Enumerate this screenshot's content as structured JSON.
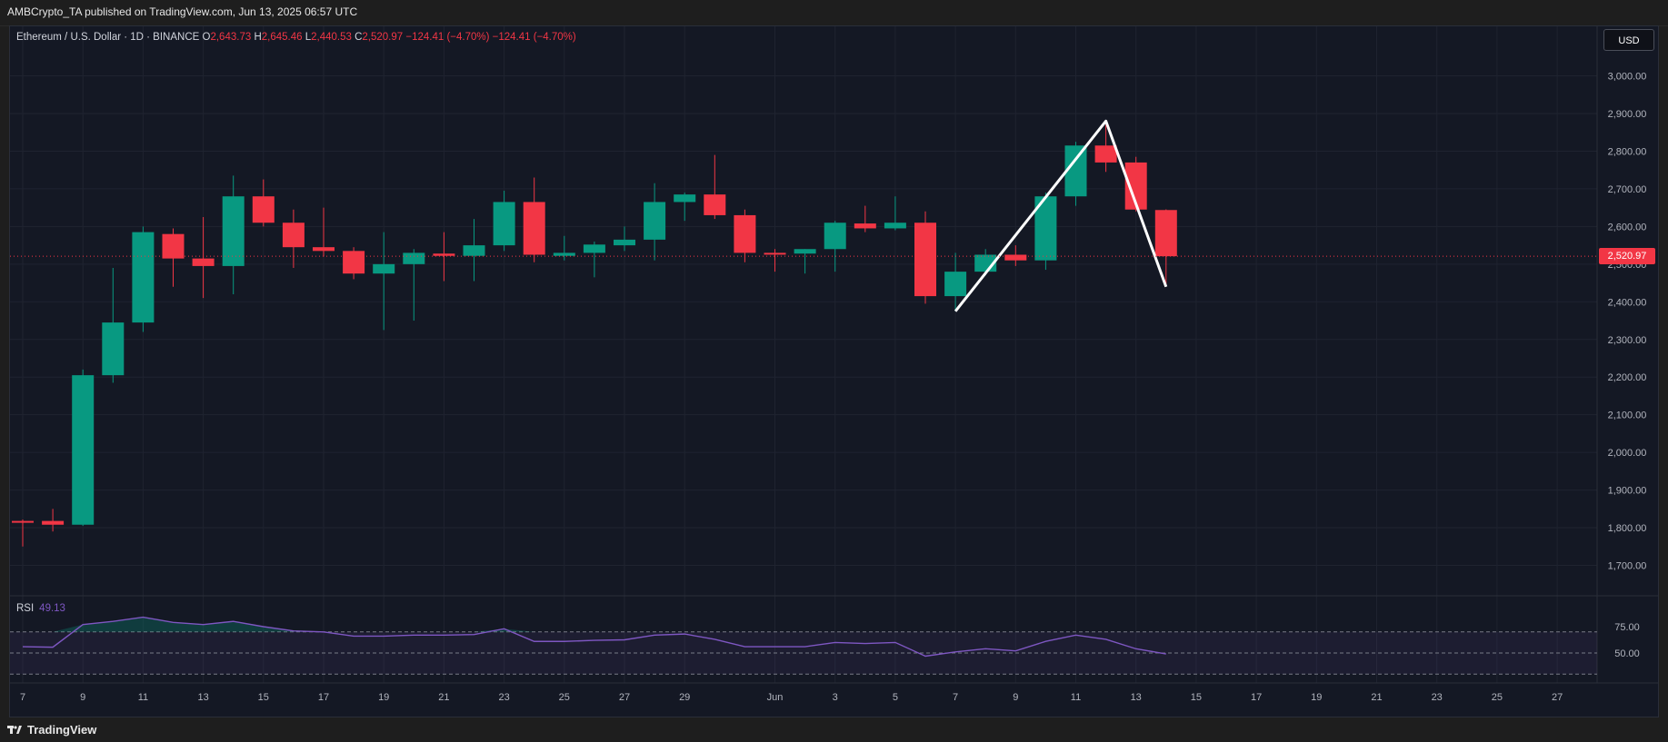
{
  "header": {
    "publisher": "AMBCrypto_TA published on TradingView.com, Jun 13, 2025 06:57 UTC"
  },
  "legend": {
    "symbol": "Ethereum / U.S. Dollar · 1D · BINANCE",
    "o_label": "O",
    "o": "2,643.73",
    "h_label": "H",
    "h": "2,645.46",
    "l_label": "L",
    "l": "2,440.53",
    "c_label": "C",
    "c": "2,520.97",
    "change": "−124.41 (−4.70%)",
    "change2": "−124.41 (−4.70%)"
  },
  "currency": "USD",
  "last_price": "2,520.97",
  "rsi": {
    "label": "RSI",
    "value": "49.13"
  },
  "footer": {
    "brand": "TradingView"
  },
  "colors": {
    "up": "#089981",
    "down": "#f23645",
    "rsi": "#7e57c2",
    "background": "#141824"
  },
  "chart_data": {
    "type": "candlestick",
    "title": "Ethereum / U.S. Dollar · 1D · BINANCE",
    "ylim": [
      1650,
      3050
    ],
    "y_ticks": [
      {
        "v": 1700,
        "label": "1,700.00"
      },
      {
        "v": 1800,
        "label": "1,800.00"
      },
      {
        "v": 1900,
        "label": "1,900.00"
      },
      {
        "v": 2000,
        "label": "2,000.00"
      },
      {
        "v": 2100,
        "label": "2,100.00"
      },
      {
        "v": 2200,
        "label": "2,200.00"
      },
      {
        "v": 2300,
        "label": "2,300.00"
      },
      {
        "v": 2400,
        "label": "2,400.00"
      },
      {
        "v": 2500,
        "label": "2,500.00"
      },
      {
        "v": 2600,
        "label": "2,600.00"
      },
      {
        "v": 2700,
        "label": "2,700.00"
      },
      {
        "v": 2800,
        "label": "2,800.00"
      },
      {
        "v": 2900,
        "label": "2,900.00"
      },
      {
        "v": 3000,
        "label": "3,000.00"
      }
    ],
    "x_ticks": [
      {
        "i": 0,
        "label": "7"
      },
      {
        "i": 2,
        "label": "9"
      },
      {
        "i": 4,
        "label": "11"
      },
      {
        "i": 6,
        "label": "13"
      },
      {
        "i": 8,
        "label": "15"
      },
      {
        "i": 10,
        "label": "17"
      },
      {
        "i": 12,
        "label": "19"
      },
      {
        "i": 14,
        "label": "21"
      },
      {
        "i": 16,
        "label": "23"
      },
      {
        "i": 18,
        "label": "25"
      },
      {
        "i": 20,
        "label": "27"
      },
      {
        "i": 22,
        "label": "29"
      },
      {
        "i": 25,
        "label": "Jun"
      },
      {
        "i": 27,
        "label": "3"
      },
      {
        "i": 29,
        "label": "5"
      },
      {
        "i": 31,
        "label": "7"
      },
      {
        "i": 33,
        "label": "9"
      },
      {
        "i": 35,
        "label": "11"
      },
      {
        "i": 37,
        "label": "13"
      },
      {
        "i": 39,
        "label": "15"
      },
      {
        "i": 41,
        "label": "17"
      },
      {
        "i": 43,
        "label": "19"
      },
      {
        "i": 45,
        "label": "21"
      },
      {
        "i": 47,
        "label": "23"
      },
      {
        "i": 49,
        "label": "25"
      },
      {
        "i": 51,
        "label": "27"
      }
    ],
    "candles": [
      {
        "date": "May 7",
        "o": 1818,
        "h": 1822,
        "l": 1750,
        "c": 1815
      },
      {
        "date": "May 8",
        "o": 1818,
        "h": 1850,
        "l": 1790,
        "c": 1808
      },
      {
        "date": "May 9",
        "o": 1808,
        "h": 2220,
        "l": 1805,
        "c": 2205
      },
      {
        "date": "May 10",
        "o": 2205,
        "h": 2490,
        "l": 2185,
        "c": 2345
      },
      {
        "date": "May 11",
        "o": 2345,
        "h": 2600,
        "l": 2320,
        "c": 2585
      },
      {
        "date": "May 12",
        "o": 2580,
        "h": 2595,
        "l": 2440,
        "c": 2515
      },
      {
        "date": "May 13",
        "o": 2515,
        "h": 2625,
        "l": 2410,
        "c": 2495
      },
      {
        "date": "May 14",
        "o": 2495,
        "h": 2735,
        "l": 2420,
        "c": 2680
      },
      {
        "date": "May 15",
        "o": 2680,
        "h": 2725,
        "l": 2600,
        "c": 2610
      },
      {
        "date": "May 16",
        "o": 2610,
        "h": 2645,
        "l": 2490,
        "c": 2545
      },
      {
        "date": "May 17",
        "o": 2545,
        "h": 2650,
        "l": 2520,
        "c": 2535
      },
      {
        "date": "May 18",
        "o": 2535,
        "h": 2545,
        "l": 2460,
        "c": 2475
      },
      {
        "date": "May 19",
        "o": 2475,
        "h": 2585,
        "l": 2325,
        "c": 2500
      },
      {
        "date": "May 20",
        "o": 2500,
        "h": 2540,
        "l": 2350,
        "c": 2530
      },
      {
        "date": "May 21",
        "o": 2528,
        "h": 2585,
        "l": 2455,
        "c": 2522
      },
      {
        "date": "May 22",
        "o": 2522,
        "h": 2620,
        "l": 2455,
        "c": 2550
      },
      {
        "date": "May 23",
        "o": 2550,
        "h": 2695,
        "l": 2535,
        "c": 2665
      },
      {
        "date": "May 24",
        "o": 2665,
        "h": 2730,
        "l": 2505,
        "c": 2525
      },
      {
        "date": "May 25",
        "o": 2522,
        "h": 2575,
        "l": 2510,
        "c": 2530
      },
      {
        "date": "May 26",
        "o": 2530,
        "h": 2560,
        "l": 2465,
        "c": 2552
      },
      {
        "date": "May 27",
        "o": 2550,
        "h": 2600,
        "l": 2535,
        "c": 2565
      },
      {
        "date": "May 28",
        "o": 2565,
        "h": 2715,
        "l": 2510,
        "c": 2665
      },
      {
        "date": "May 29",
        "o": 2665,
        "h": 2690,
        "l": 2615,
        "c": 2685
      },
      {
        "date": "May 30",
        "o": 2685,
        "h": 2790,
        "l": 2620,
        "c": 2630
      },
      {
        "date": "May 31",
        "o": 2630,
        "h": 2645,
        "l": 2505,
        "c": 2530
      },
      {
        "date": "Jun 1",
        "o": 2530,
        "h": 2540,
        "l": 2480,
        "c": 2528
      },
      {
        "date": "Jun 2",
        "o": 2528,
        "h": 2540,
        "l": 2475,
        "c": 2540
      },
      {
        "date": "Jun 3",
        "o": 2540,
        "h": 2615,
        "l": 2480,
        "c": 2610
      },
      {
        "date": "Jun 4",
        "o": 2608,
        "h": 2655,
        "l": 2585,
        "c": 2595
      },
      {
        "date": "Jun 5",
        "o": 2595,
        "h": 2680,
        "l": 2590,
        "c": 2610
      },
      {
        "date": "Jun 6",
        "o": 2610,
        "h": 2640,
        "l": 2395,
        "c": 2415
      },
      {
        "date": "Jun 7",
        "o": 2415,
        "h": 2530,
        "l": 2375,
        "c": 2480
      },
      {
        "date": "Jun 8",
        "o": 2480,
        "h": 2540,
        "l": 2470,
        "c": 2525
      },
      {
        "date": "Jun 9",
        "o": 2525,
        "h": 2550,
        "l": 2495,
        "c": 2510
      },
      {
        "date": "Jun 10",
        "o": 2510,
        "h": 2690,
        "l": 2485,
        "c": 2680
      },
      {
        "date": "Jun 11",
        "o": 2680,
        "h": 2825,
        "l": 2655,
        "c": 2815
      },
      {
        "date": "Jun 12",
        "o": 2815,
        "h": 2870,
        "l": 2745,
        "c": 2770
      },
      {
        "date": "Jun 13",
        "o": 2770,
        "h": 2785,
        "l": 2640,
        "c": 2645
      },
      {
        "date": "Jun 14",
        "o": 2643.73,
        "h": 2645.46,
        "l": 2440.53,
        "c": 2520.97
      }
    ],
    "drawn_line": [
      {
        "i": 31,
        "v": 2375
      },
      {
        "i": 36,
        "v": 2880
      },
      {
        "i": 38,
        "v": 2440
      }
    ],
    "rsi": {
      "ylim": [
        20,
        100
      ],
      "y_ticks": [
        {
          "v": 75,
          "label": "75.00"
        },
        {
          "v": 50,
          "label": "50.00"
        }
      ],
      "band_upper": 70,
      "band_lower": 30,
      "mid": 50,
      "values": [
        56,
        55.5,
        77,
        80,
        84,
        79,
        77,
        80,
        75,
        71,
        70,
        66,
        66,
        67,
        67,
        67.5,
        73,
        61,
        61,
        62,
        62.5,
        67,
        68,
        63,
        56,
        56,
        56,
        60,
        59,
        60,
        47,
        51,
        54,
        52,
        61,
        67,
        63,
        54,
        49.13
      ]
    }
  }
}
